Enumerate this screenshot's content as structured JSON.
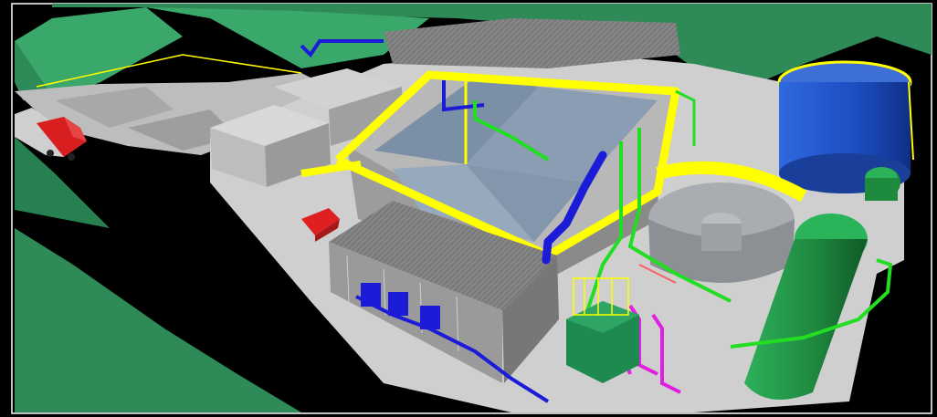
{
  "scene": {
    "colors": {
      "background": "#000000",
      "terrain": "#2e8b57",
      "slab": "#c8c8c8",
      "wall": "#a9a9a9",
      "roof": "#7b7b7b",
      "walkway": "#ffff00",
      "pipe_blue": "#1b1bd8",
      "pipe_green": "#22dd22",
      "pipe_magenta": "#e020e0",
      "tank_blue": "#1f4fc8",
      "tank_green": "#1e8a3e",
      "truck_red": "#d81e1e",
      "car_red": "#e02020",
      "border": "#ffffff"
    },
    "objects": [
      "hillside-terrain",
      "parking-area",
      "site-building",
      "settling-basin",
      "covered-shed",
      "blue-storage-tank",
      "clarifier",
      "green-vertical-tank",
      "pipe-racks",
      "truck",
      "red-car"
    ]
  }
}
